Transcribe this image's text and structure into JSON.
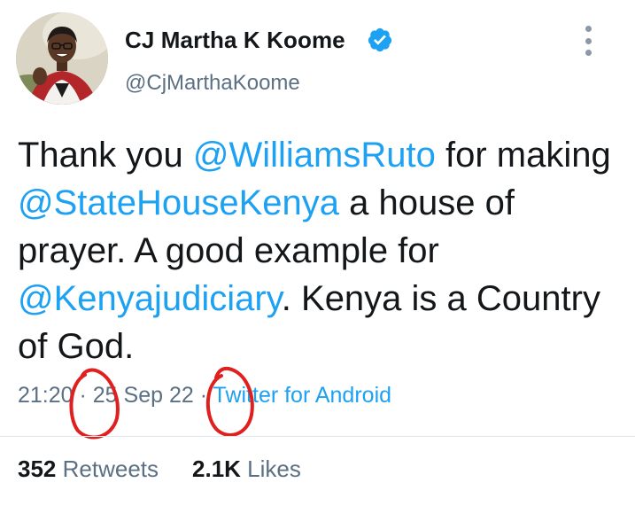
{
  "header": {
    "display_name": "CJ Martha K Koome",
    "handle": "@CjMarthaKoome",
    "verified_icon": "verified-badge-icon",
    "more_icon": "more-vertical-icon"
  },
  "tweet": {
    "text_parts": [
      "Thank you ",
      "@WilliamsRuto",
      " for making ",
      "@StateHouseKenya",
      " a house of prayer. A good example for ",
      "@Kenyajudiciary",
      ". Kenya is a Country of God."
    ]
  },
  "meta": {
    "time": "21:20",
    "separator": " · ",
    "date": "25 Sep 22",
    "source": "Twitter for Android"
  },
  "stats": {
    "retweets_count": "352",
    "retweets_label": "Retweets",
    "likes_count": "2.1K",
    "likes_label": "Likes"
  },
  "colors": {
    "link": "#1da1f2",
    "muted": "#5b7083",
    "annotation": "#e0201f"
  }
}
